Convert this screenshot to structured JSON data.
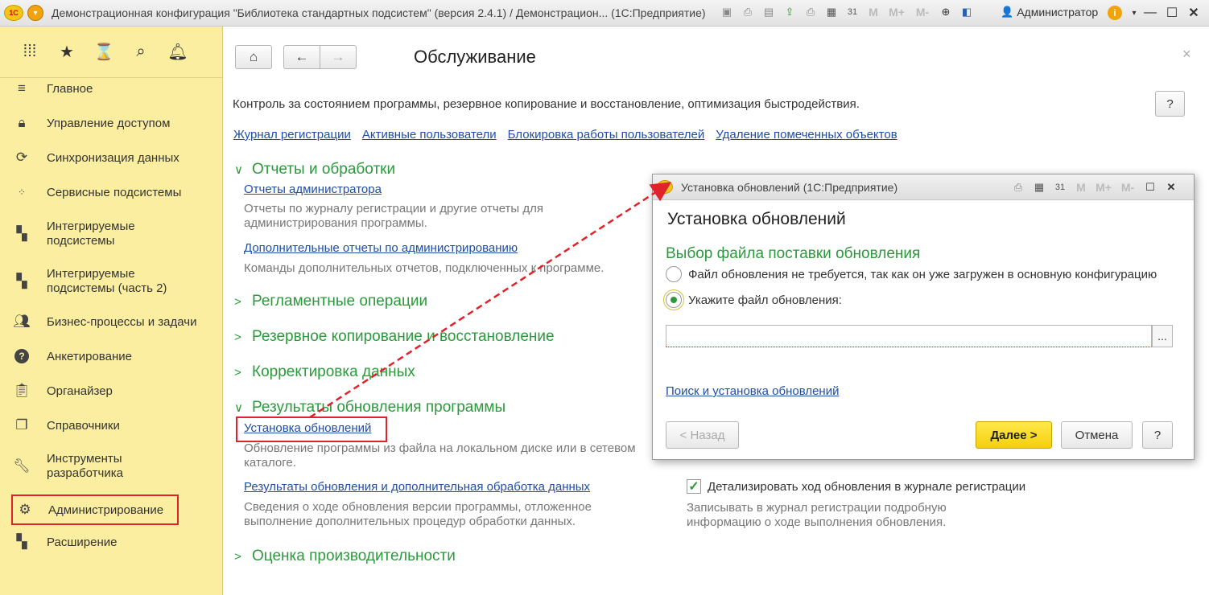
{
  "window": {
    "title": "Демонстрационная конфигурация \"Библиотека стандартных подсистем\" (версия 2.4.1) / Демонстрацион... (1С:Предприятие)",
    "user": "Администратор",
    "toolbar_marks": [
      "M",
      "M+",
      "M-"
    ]
  },
  "sidebar": {
    "items": [
      {
        "label": "Главное",
        "icon": "menu-lines-icon"
      },
      {
        "label": "Управление доступом",
        "icon": "lock-icon"
      },
      {
        "label": "Синхронизация данных",
        "icon": "sync-icon"
      },
      {
        "label": "Сервисные подсистемы",
        "icon": "grid-dots-icon"
      },
      {
        "label": "Интегрируемые подсистемы",
        "icon": "blocks-icon"
      },
      {
        "label": "Интегрируемые подсистемы (часть 2)",
        "icon": "blocks-icon"
      },
      {
        "label": "Бизнес-процессы и задачи",
        "icon": "users-icon"
      },
      {
        "label": "Анкетирование",
        "icon": "question-icon"
      },
      {
        "label": "Органайзер",
        "icon": "clipboard-icon"
      },
      {
        "label": "Справочники",
        "icon": "books-icon"
      },
      {
        "label": "Инструменты разработчика",
        "icon": "wrench-icon"
      },
      {
        "label": "Администрирование",
        "icon": "gear-icon"
      },
      {
        "label": "Расширение",
        "icon": "blocks-icon"
      }
    ]
  },
  "main": {
    "title": "Обслуживание",
    "description": "Контроль за состоянием программы, резервное копирование и восстановление, оптимизация быстродействия.",
    "help": "?",
    "top_links": [
      "Журнал регистрации",
      "Активные пользователи",
      "Блокировка работы пользователей",
      "Удаление помеченных объектов"
    ],
    "sections": {
      "reports": {
        "title": "Отчеты и обработки",
        "link1": "Отчеты администратора",
        "desc1": "Отчеты по журналу регистрации и другие отчеты для администрирования программы.",
        "link2": "Дополнительные отчеты по администрированию",
        "desc2": "Команды дополнительных отчетов, подключенных к программе."
      },
      "routine": {
        "title": "Регламентные операции"
      },
      "backup": {
        "title": "Резервное копирование и восстановление"
      },
      "correction": {
        "title": "Корректировка данных"
      },
      "update": {
        "title": "Результаты обновления программы",
        "link1": "Установка обновлений",
        "desc1": "Обновление программы из файла на локальном диске или в сетевом каталоге.",
        "link2": "Результаты обновления и дополнительная обработка данных",
        "desc2": "Сведения о ходе обновления версии программы, отложенное выполнение дополнительных процедур обработки данных.",
        "checkbox_label": "Детализировать ход обновления в журнале регистрации",
        "checkbox_checked": true,
        "checkbox_desc": "Записывать в журнал регистрации подробную информацию о ходе выполнения обновления."
      },
      "performance": {
        "title": "Оценка производительности"
      }
    }
  },
  "dialog": {
    "window_title": "Установка обновлений  (1С:Предприятие)",
    "heading": "Установка обновлений",
    "subheading": "Выбор файла поставки обновления",
    "option1": "Файл обновления не требуется, так как он уже загружен в основную конфигурацию",
    "option2": "Укажите файл обновления:",
    "selected_option": 2,
    "file_value": "",
    "browse": "...",
    "search_link": "Поиск и установка обновлений",
    "back": "< Назад",
    "next": "Далее >",
    "cancel": "Отмена",
    "help": "?"
  },
  "colors": {
    "sidebar_bg": "#fbeea0",
    "section_green": "#2b9a3a",
    "link_blue": "#1f4ea6",
    "highlight_red": "#e0222a",
    "primary_yellow": "#f5cf0c"
  }
}
